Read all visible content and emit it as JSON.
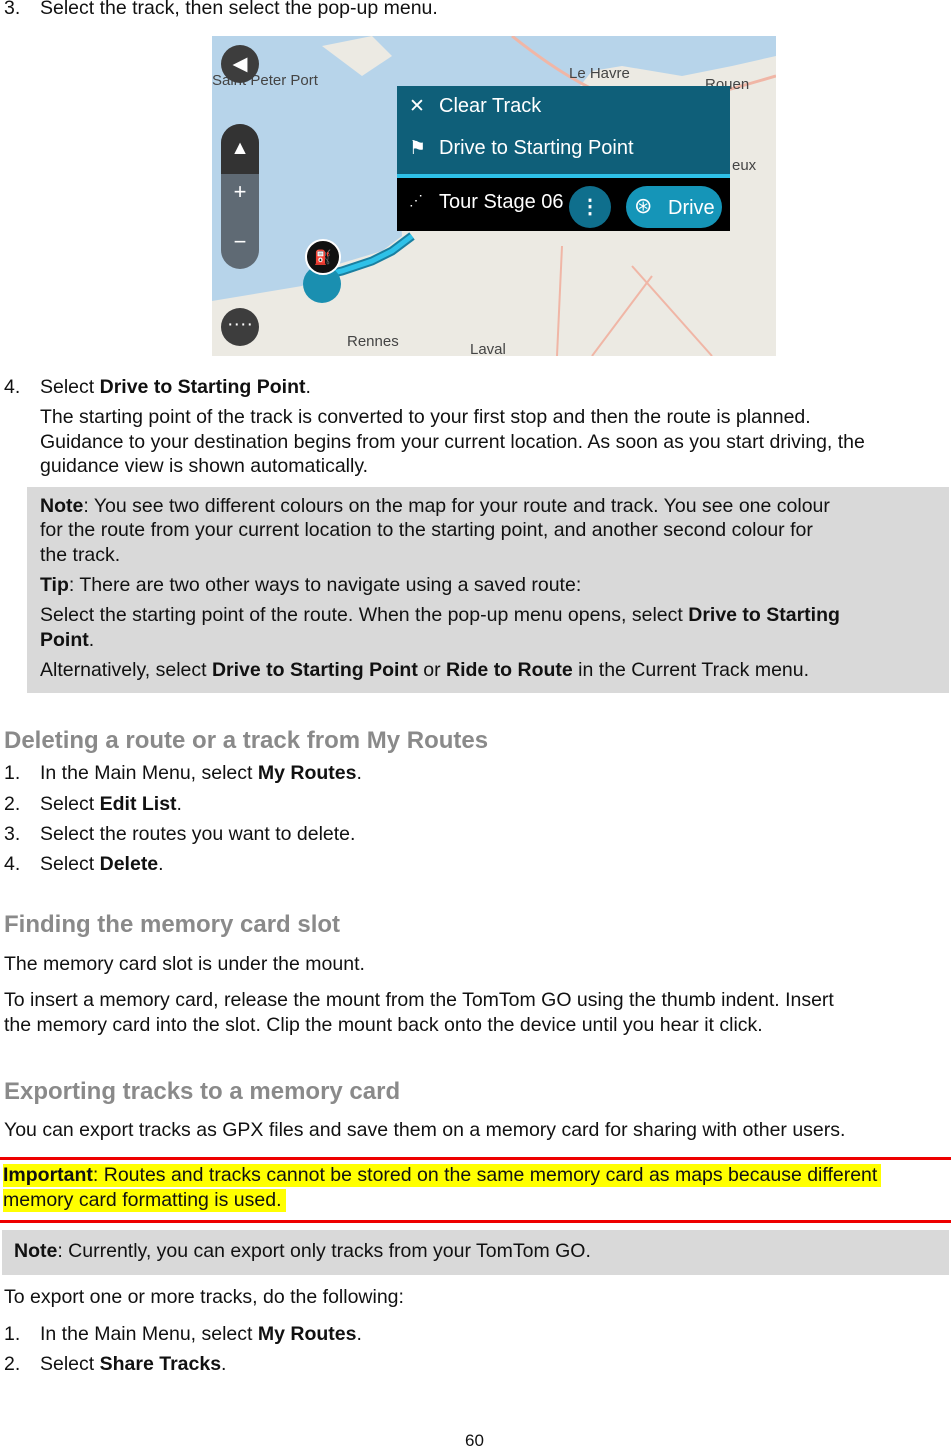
{
  "step3": {
    "num": "3.",
    "text": "Select the track, then select the pop-up menu."
  },
  "map": {
    "labels": [
      "Saint Peter Port",
      "Le Havre",
      "Rouen",
      "eux",
      "Rennes",
      "Laval"
    ],
    "menu": {
      "clear_track": "Clear Track",
      "drive_to_start": "Drive to Starting Point",
      "track_name": "Tour Stage 06",
      "drive": "Drive"
    },
    "colors": {
      "menu_bg": "#0f5f79",
      "route": "#2ec1e8",
      "sea": "#b7d4ea"
    }
  },
  "step4": {
    "num": "4.",
    "pre": "Select ",
    "bold": "Drive to Starting Point",
    "post": ".",
    "para": [
      "The starting point of the track is converted to your first stop and then the route is planned.",
      "Guidance to your destination begins from your current location. As soon as you start driving, the",
      "guidance view is shown automatically."
    ]
  },
  "note1": {
    "label": "Note",
    "l1": ": You see two different colours on the map for your route and track. You see one colour",
    "l2": "for the route from your current location to the starting point, and another second colour for",
    "l3": "the track.",
    "tip_label": "Tip",
    "tip": ": There are two other ways to navigate using a saved route:",
    "s1": "Select the starting point of the route. When the pop-up menu opens, select ",
    "s1b": "Drive to Starting",
    "s2b": "Point",
    "s2": ".",
    "a1": "Alternatively, select ",
    "a1b": "Drive to Starting Point",
    "a2": " or ",
    "a2b": "Ride to Route",
    "a3": " in the Current Track menu."
  },
  "delete": {
    "heading": "Deleting a route or a track from My Routes",
    "steps": [
      {
        "num": "1.",
        "pre": "In the Main Menu, select ",
        "bold": "My Routes",
        "post": "."
      },
      {
        "num": "2.",
        "pre": "Select ",
        "bold": "Edit List",
        "post": "."
      },
      {
        "num": "3.",
        "pre": "Select the routes you want to delete.",
        "bold": "",
        "post": ""
      },
      {
        "num": "4.",
        "pre": "Select ",
        "bold": "Delete",
        "post": "."
      }
    ]
  },
  "slot": {
    "heading": "Finding the memory card slot",
    "p1": "The memory card slot is under the mount.",
    "p2a": "To insert a memory card, release the mount from the TomTom GO using the thumb indent. Insert",
    "p2b": "the memory card into the slot. Clip the mount back onto the device until you hear it click."
  },
  "export": {
    "heading": "Exporting tracks to a memory card",
    "p1": "You can export tracks as GPX files and save them on a memory card for sharing with other users.",
    "important_label": "Important",
    "important_l1": ": Routes and tracks cannot be stored on the same memory card as maps because different",
    "important_l2": "memory card formatting is used.",
    "note_label": "Note",
    "note": ": Currently, you can export only tracks from your TomTom GO.",
    "p2": "To export one or more tracks, do the following:",
    "steps": [
      {
        "num": "1.",
        "pre": "In the Main Menu, select ",
        "bold": "My Routes",
        "post": "."
      },
      {
        "num": "2.",
        "pre": "Select ",
        "bold": "Share Tracks",
        "post": "."
      }
    ]
  },
  "page_number": "60"
}
